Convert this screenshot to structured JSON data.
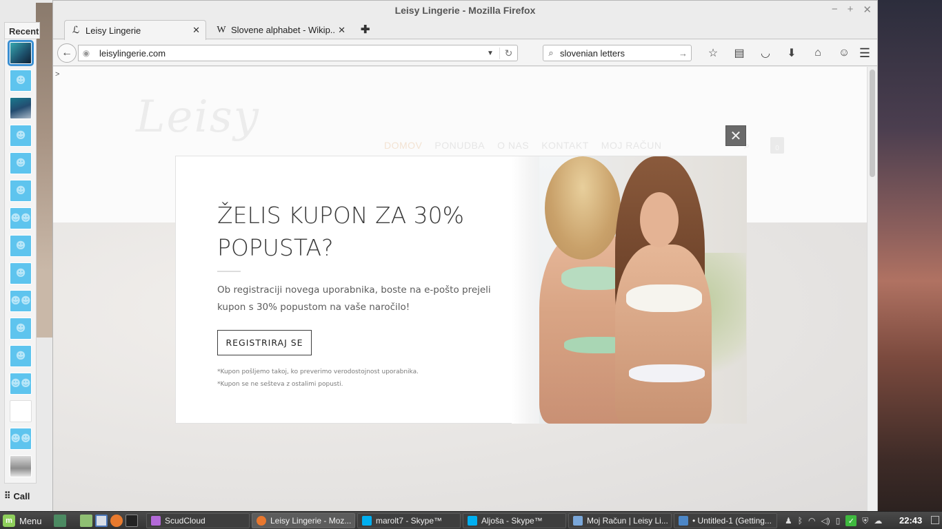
{
  "desktop": {},
  "skype": {
    "recent_label": "Recent",
    "call_label": "Call",
    "contacts": [
      {
        "kind": "photo1",
        "icon": "avatar-photo"
      },
      {
        "kind": "default",
        "icon": "person-icon"
      },
      {
        "kind": "photo2",
        "icon": "avatar-photo"
      },
      {
        "kind": "default",
        "icon": "person-icon"
      },
      {
        "kind": "default",
        "icon": "person-icon"
      },
      {
        "kind": "default",
        "icon": "person-icon"
      },
      {
        "kind": "group",
        "icon": "group-icon"
      },
      {
        "kind": "default",
        "icon": "person-icon"
      },
      {
        "kind": "default",
        "icon": "person-icon"
      },
      {
        "kind": "group",
        "icon": "group-icon"
      },
      {
        "kind": "default",
        "icon": "person-icon"
      },
      {
        "kind": "default",
        "icon": "person-icon"
      },
      {
        "kind": "group",
        "icon": "group-icon"
      },
      {
        "kind": "blank",
        "icon": "blank-avatar"
      },
      {
        "kind": "group",
        "icon": "group-icon"
      },
      {
        "kind": "photo3",
        "icon": "avatar-photo"
      }
    ]
  },
  "firefox": {
    "window_title": "Leisy Lingerie - Mozilla Firefox",
    "window_controls": {
      "minimize": "−",
      "maximize": "+",
      "close": "✕"
    },
    "tabs": [
      {
        "title": "Leisy Lingerie",
        "active": true,
        "icon": "leisy-favicon"
      },
      {
        "title": "Slovene alphabet - Wikip...",
        "active": false,
        "icon": "wikipedia-icon",
        "glyph": "W"
      }
    ],
    "tab_close_glyph": "✕",
    "new_tab_glyph": "✚",
    "url": "leisylingerie.com",
    "search_query": "slovenian letters",
    "toolbar_icons": [
      "bookmark-star-icon",
      "reading-list-icon",
      "pocket-icon",
      "downloads-icon",
      "home-icon",
      "chat-icon"
    ]
  },
  "page": {
    "caret": ">",
    "logo_text": "Leisy",
    "nav": [
      "DOMOV",
      "PONUDBA",
      "O NAS",
      "KONTAKT",
      "MOJ RAČUN"
    ],
    "cart_count": "0"
  },
  "modal": {
    "heading": "ŽELIS KUPON ZA 30% POPUSTA?",
    "body": "Ob registraciji novega uporabnika, boste na e-pošto prejeli kupon s 30% popustom na vaše naročilo!",
    "cta_label": "REGISTRIRAJ SE",
    "note_1": "*Kupon pošljemo takoj, ko preverimo verodostojnost uporabnika.",
    "note_2": "*Kupon se ne sešteva z ostalimi popusti.",
    "close_glyph": "✕"
  },
  "taskbar": {
    "menu_label": "Menu",
    "tasks": [
      {
        "label": "ScudCloud",
        "icon": "scudcloud-icon",
        "color": "#b36ad8"
      },
      {
        "label": "Leisy Lingerie - Moz...",
        "icon": "firefox-icon",
        "color": "#e8772e",
        "active": true
      },
      {
        "label": "marolt7 - Skype™",
        "icon": "skype-icon",
        "color": "#00aff0"
      },
      {
        "label": "Aljoša - Skype™",
        "icon": "skype-icon",
        "color": "#00aff0"
      },
      {
        "label": "Moj Račun | Leisy Li...",
        "icon": "window-icon",
        "color": "#7aa7d9"
      },
      {
        "label": "• Untitled-1 (Getting...",
        "icon": "editor-icon",
        "color": "#4c86c6"
      }
    ],
    "clock": "22:43"
  },
  "colors": {
    "tab_active": "#f4f4f4",
    "modal_bg": "#ffffff",
    "modal_close_bg": "#6a6a6a",
    "skype_avatar": "#5ec4ee",
    "taskbar": "#3e3e3e"
  }
}
